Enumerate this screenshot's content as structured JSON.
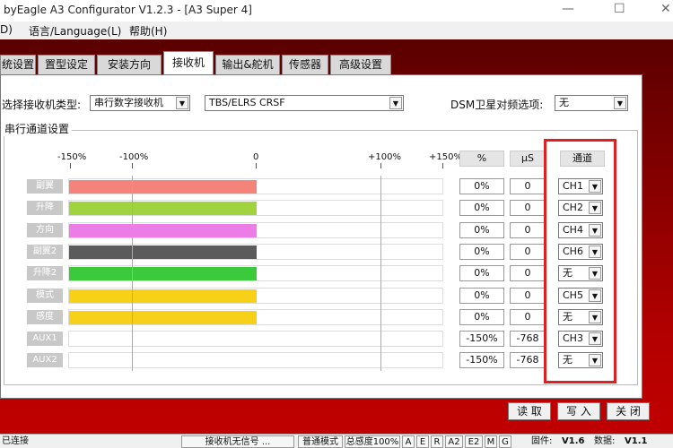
{
  "window": {
    "title": "byEagle A3 Configurator V1.2.3 - [A3 Super 4]",
    "min": "—",
    "max": "☐",
    "close": "✕"
  },
  "menu": [
    "D)",
    "语言/Language(L)",
    "帮助(H)"
  ],
  "tabs": [
    "统设置",
    "置型设定",
    "安装方向",
    "接收机",
    "输出&舵机",
    "传感器",
    "高级设置"
  ],
  "receiver": {
    "type_label": "选择接收机类型:",
    "type_value": "串行数字接收机",
    "protocol_value": "TBS/ELRS CRSF",
    "dsm_label": "DSM卫星对频选项:",
    "dsm_value": "无"
  },
  "serial_group": {
    "title": "串行通道设置",
    "ticks": [
      "-150%",
      "-100%",
      "0",
      "+100%",
      "+150%"
    ],
    "headers": {
      "percent": "%",
      "us": "μS",
      "channel": "通道"
    },
    "rows": [
      {
        "label": "副翼",
        "color": "#f4837a",
        "fill": 0.5,
        "percent": "0%",
        "us": "0",
        "channel": "CH1"
      },
      {
        "label": "升降",
        "color": "#9fd43f",
        "fill": 0.5,
        "percent": "0%",
        "us": "0",
        "channel": "CH2"
      },
      {
        "label": "方向",
        "color": "#ec7de6",
        "fill": 0.5,
        "percent": "0%",
        "us": "0",
        "channel": "CH4"
      },
      {
        "label": "副翼2",
        "color": "#5b5b5b",
        "fill": 0.5,
        "percent": "0%",
        "us": "0",
        "channel": "CH6"
      },
      {
        "label": "升降2",
        "color": "#3cc93c",
        "fill": 0.5,
        "percent": "0%",
        "us": "0",
        "channel": "无"
      },
      {
        "label": "模式",
        "color": "#f7d117",
        "fill": 0.5,
        "percent": "0%",
        "us": "0",
        "channel": "CH5"
      },
      {
        "label": "感度",
        "color": "#f7d117",
        "fill": 0.5,
        "percent": "0%",
        "us": "0",
        "channel": "无"
      },
      {
        "label": "AUX1",
        "color": "#ffffff",
        "fill": 0,
        "percent": "-150%",
        "us": "-768",
        "channel": "CH3"
      },
      {
        "label": "AUX2",
        "color": "#ffffff",
        "fill": 0,
        "percent": "-150%",
        "us": "-768",
        "channel": "无"
      }
    ]
  },
  "buttons": {
    "read": "读 取",
    "write": "写 入",
    "close": "关 闭"
  },
  "status": {
    "connection": "已连接",
    "receiver": "接收机无信号 ...",
    "mode": "普通模式",
    "sens": "总感度100%",
    "flags": [
      "A",
      "E",
      "R",
      "A2",
      "E2",
      "M",
      "G"
    ],
    "firmware_label": "固件:",
    "firmware": "V1.6",
    "data_label": "数据:",
    "data": "V1.1"
  }
}
